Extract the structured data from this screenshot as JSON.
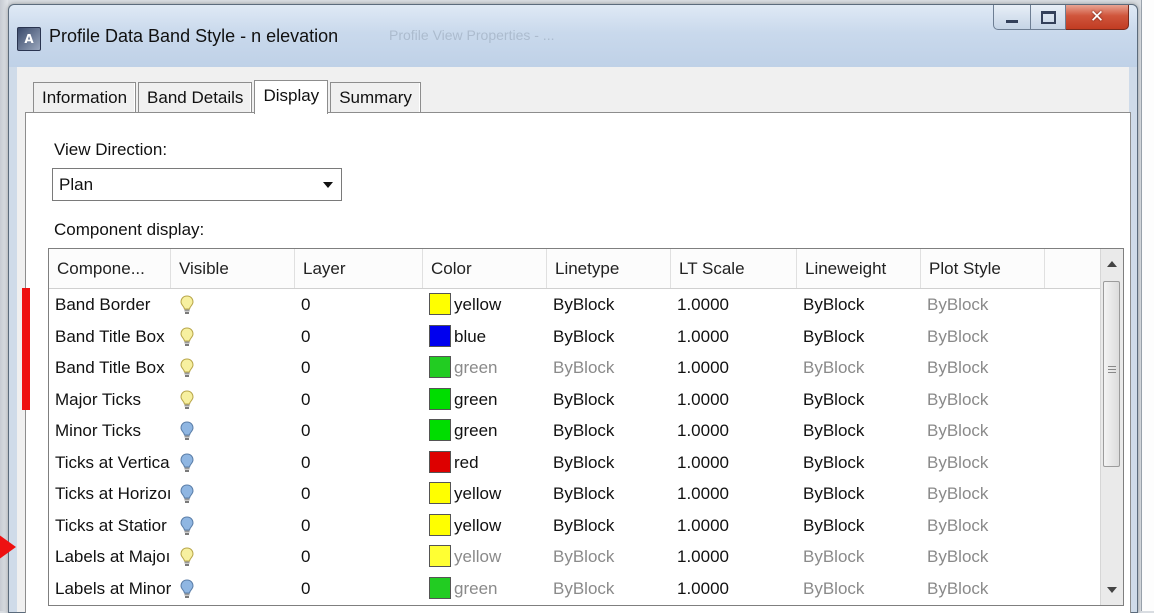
{
  "window": {
    "title": "Profile Data Band Style - n elevation",
    "ghost_title": "Profile View Properties - ..."
  },
  "tabs": [
    {
      "label": "Information"
    },
    {
      "label": "Band Details"
    },
    {
      "label": "Display"
    },
    {
      "label": "Summary"
    }
  ],
  "view_direction": {
    "label": "View Direction:",
    "value": "Plan"
  },
  "component_display": {
    "label": "Component display:",
    "columns": [
      "Compone...",
      "Visible",
      "Layer",
      "Color",
      "Linetype",
      "LT Scale",
      "Lineweight",
      "Plot Style"
    ],
    "rows": [
      {
        "component": "Band Border",
        "visible": "on",
        "layer": "0",
        "color": "yellow",
        "color_hex": "#ffff00",
        "color_dim": false,
        "linetype": "ByBlock",
        "linetype_dim": false,
        "lt_scale": "1.0000",
        "lineweight": "ByBlock",
        "lineweight_dim": false,
        "plot_style": "ByBlock"
      },
      {
        "component": "Band Title Box",
        "visible": "on",
        "layer": "0",
        "color": "blue",
        "color_hex": "#0000ee",
        "color_dim": false,
        "linetype": "ByBlock",
        "linetype_dim": false,
        "lt_scale": "1.0000",
        "lineweight": "ByBlock",
        "lineweight_dim": false,
        "plot_style": "ByBlock"
      },
      {
        "component": "Band Title Box",
        "visible": "on",
        "layer": "0",
        "color": "green",
        "color_hex": "#22cc22",
        "color_dim": true,
        "linetype": "ByBlock",
        "linetype_dim": true,
        "lt_scale": "1.0000",
        "lineweight": "ByBlock",
        "lineweight_dim": true,
        "plot_style": "ByBlock"
      },
      {
        "component": "Major Ticks",
        "visible": "on",
        "layer": "0",
        "color": "green",
        "color_hex": "#00dd00",
        "color_dim": false,
        "linetype": "ByBlock",
        "linetype_dim": false,
        "lt_scale": "1.0000",
        "lineweight": "ByBlock",
        "lineweight_dim": false,
        "plot_style": "ByBlock"
      },
      {
        "component": "Minor Ticks",
        "visible": "off",
        "layer": "0",
        "color": "green",
        "color_hex": "#00dd00",
        "color_dim": false,
        "linetype": "ByBlock",
        "linetype_dim": false,
        "lt_scale": "1.0000",
        "lineweight": "ByBlock",
        "lineweight_dim": false,
        "plot_style": "ByBlock"
      },
      {
        "component": "Ticks at Vertica",
        "visible": "off",
        "layer": "0",
        "color": "red",
        "color_hex": "#dd0000",
        "color_dim": false,
        "linetype": "ByBlock",
        "linetype_dim": false,
        "lt_scale": "1.0000",
        "lineweight": "ByBlock",
        "lineweight_dim": false,
        "plot_style": "ByBlock"
      },
      {
        "component": "Ticks at Horizoı",
        "visible": "off",
        "layer": "0",
        "color": "yellow",
        "color_hex": "#ffff00",
        "color_dim": false,
        "linetype": "ByBlock",
        "linetype_dim": false,
        "lt_scale": "1.0000",
        "lineweight": "ByBlock",
        "lineweight_dim": false,
        "plot_style": "ByBlock"
      },
      {
        "component": "Ticks at Statior",
        "visible": "off",
        "layer": "0",
        "color": "yellow",
        "color_hex": "#ffff00",
        "color_dim": false,
        "linetype": "ByBlock",
        "linetype_dim": false,
        "lt_scale": "1.0000",
        "lineweight": "ByBlock",
        "lineweight_dim": false,
        "plot_style": "ByBlock"
      },
      {
        "component": "Labels at Majoı",
        "visible": "on",
        "layer": "0",
        "color": "yellow",
        "color_hex": "#ffff33",
        "color_dim": true,
        "linetype": "ByBlock",
        "linetype_dim": true,
        "lt_scale": "1.0000",
        "lineweight": "ByBlock",
        "lineweight_dim": true,
        "plot_style": "ByBlock"
      },
      {
        "component": "Labels at Minor",
        "visible": "off",
        "layer": "0",
        "color": "green",
        "color_hex": "#22cc22",
        "color_dim": true,
        "linetype": "ByBlock",
        "linetype_dim": true,
        "lt_scale": "1.0000",
        "lineweight": "ByBlock",
        "lineweight_dim": true,
        "plot_style": "ByBlock"
      }
    ]
  },
  "icons": {
    "app": "autocad-civil-app-icon",
    "visible_on": "lightbulb-on-icon",
    "visible_off": "lightbulb-off-icon"
  },
  "colors": {
    "bulb_on": "#f7f0a0",
    "bulb_off": "#8fb6e2",
    "marker": "#ee1111"
  }
}
